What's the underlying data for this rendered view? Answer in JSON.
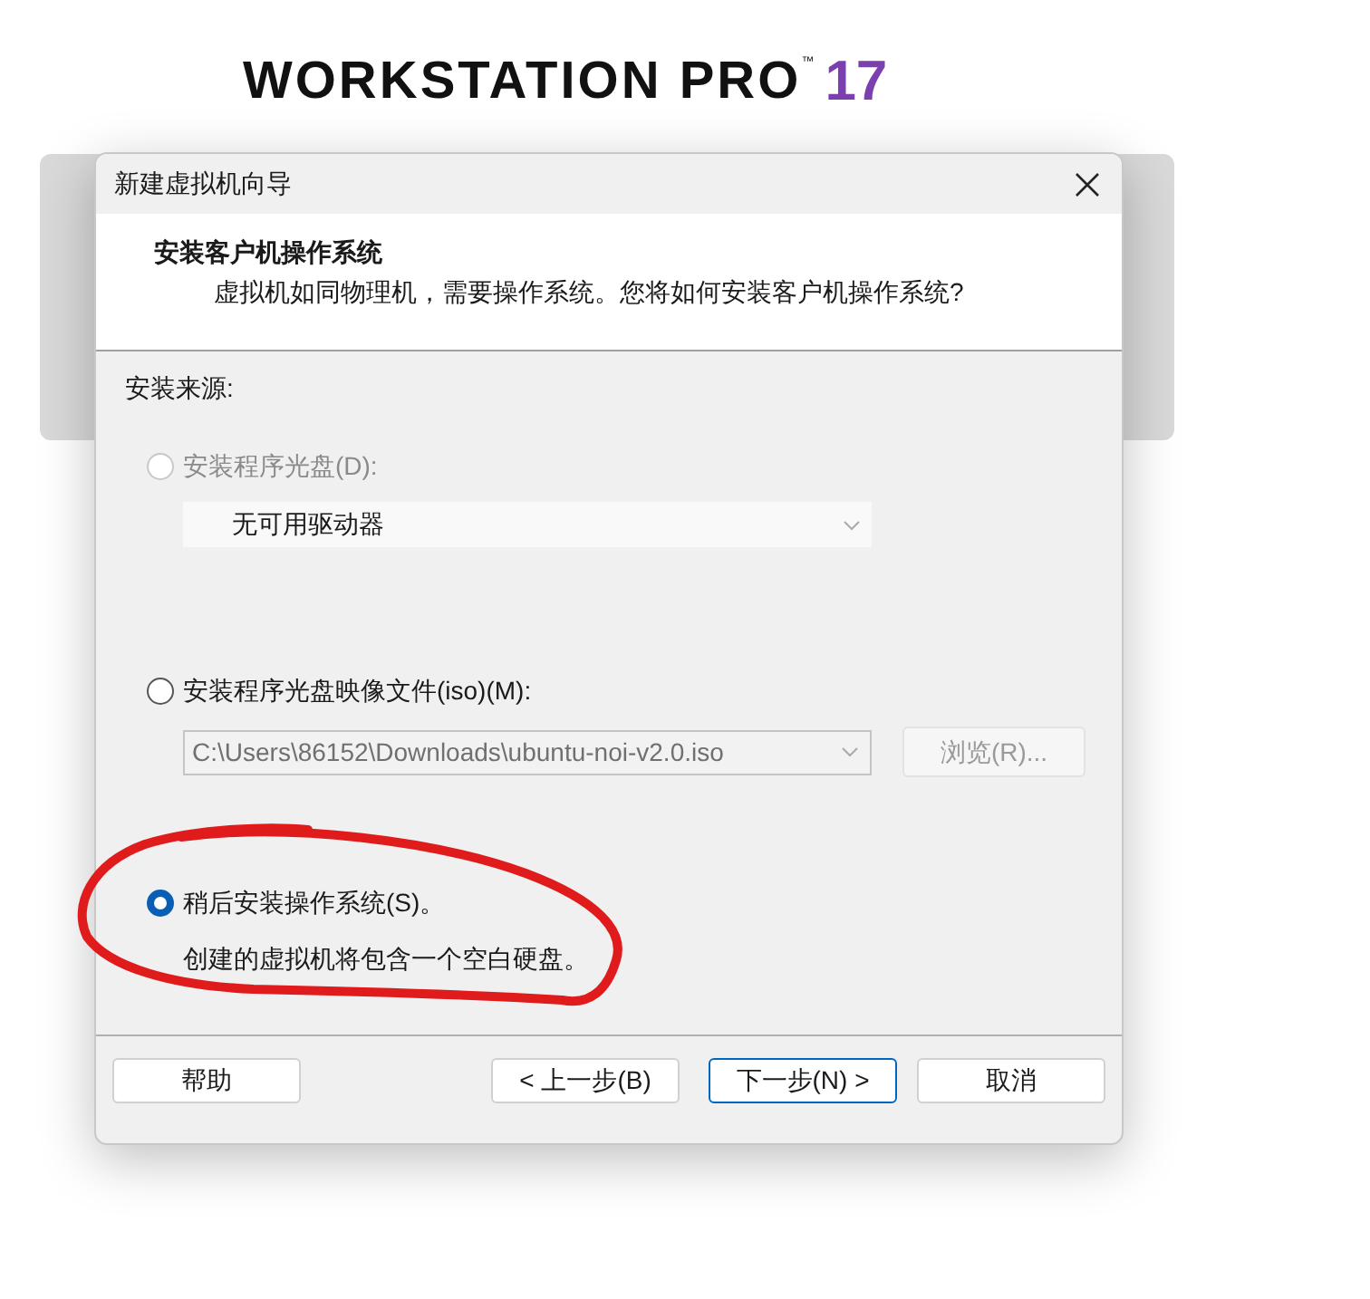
{
  "app_logo": {
    "name": "WORKSTATION PRO",
    "trademark": "™",
    "version": "17"
  },
  "dialog": {
    "title": "新建虚拟机向导",
    "header": {
      "title": "安装客户机操作系统",
      "subtitle": "虚拟机如同物理机，需要操作系统。您将如何安装客户机操作系统?"
    },
    "section_label": "安装来源:",
    "options": [
      {
        "kind": "disc",
        "label": "安装程序光盘(D):",
        "selected": false,
        "disabled": true,
        "dropdown": {
          "value": "无可用驱动器"
        }
      },
      {
        "kind": "iso",
        "label": "安装程序光盘映像文件(iso)(M):",
        "selected": false,
        "disabled": false,
        "path": {
          "value": "C:\\Users\\86152\\Downloads\\ubuntu-noi-v2.0.iso"
        },
        "browse_button": {
          "label": "浏览(R)...",
          "disabled": true
        }
      },
      {
        "kind": "later",
        "label": "稍后安装操作系统(S)。",
        "selected": true,
        "disabled": false,
        "note": "创建的虚拟机将包含一个空白硬盘。"
      }
    ],
    "buttons": [
      {
        "label": "帮助",
        "default": false
      },
      {
        "label": "< 上一步(B)",
        "default": false
      },
      {
        "label": "下一步(N) >",
        "default": true
      },
      {
        "label": "取消",
        "default": false
      }
    ]
  }
}
